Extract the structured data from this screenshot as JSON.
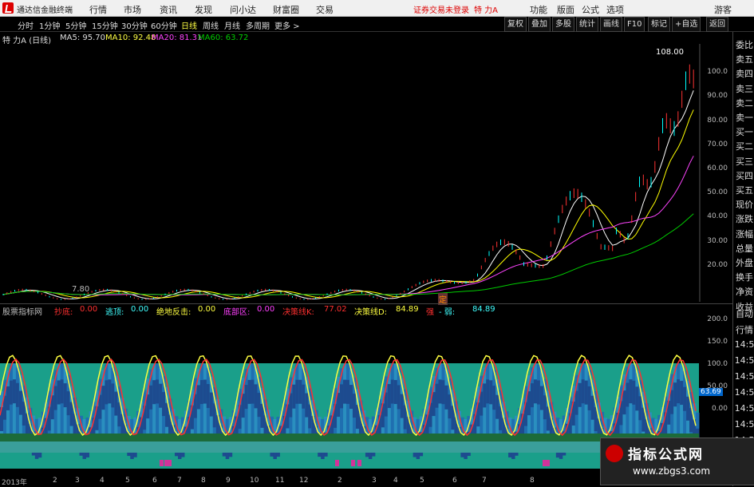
{
  "app": {
    "title": "通达信金融终端"
  },
  "menu": [
    "行情",
    "市场",
    "资讯",
    "发现",
    "问小达",
    "财富圈",
    "交易"
  ],
  "notice": "证券交易未登录",
  "stock_title": "特 力A",
  "right_buttons": [
    "功能",
    "版面",
    "公式",
    "选项",
    "游客"
  ],
  "periods": [
    "分时",
    "1分钟",
    "5分钟",
    "15分钟",
    "30分钟",
    "60分钟",
    "日线",
    "周线",
    "月线",
    "多周期",
    "更多 >"
  ],
  "active_period": "日线",
  "toolbar": [
    "复权",
    "叠加",
    "多股",
    "统计",
    "画线",
    "F10",
    "标记",
    "+自选",
    "返回"
  ],
  "main_chart": {
    "name": "特 力A (日线)",
    "ma5": "MA5: 95.70",
    "ma10": "MA10: 92.48",
    "ma20": "MA20: 81.31",
    "ma60": "MA60: 63.72",
    "price_high": "108.00",
    "price_low": "7.80",
    "marker": "定",
    "y_ticks": [
      "100.0",
      "90.00",
      "80.00",
      "70.00",
      "60.00",
      "50.00",
      "40.00",
      "30.00",
      "20.00"
    ],
    "colors": {
      "ma5": "#ffffff",
      "ma10": "#ffff00",
      "ma20": "#ff44ff",
      "ma60": "#00cc00",
      "up": "#ff3333",
      "down": "#00ffff"
    }
  },
  "indicator": {
    "name": "股票指标网",
    "fields": [
      {
        "label": "抄底:",
        "value": "0.00",
        "color": "#ff3030"
      },
      {
        "label": "逃顶:",
        "value": "0.00",
        "color": "#40ffff"
      },
      {
        "label": "绝地反击:",
        "value": "0.00",
        "color": "#ffff40"
      },
      {
        "label": "底部区:",
        "value": "0.00",
        "color": "#ff40ff"
      },
      {
        "label": "决策线K:",
        "value": "77.02",
        "color": "#ff3030"
      },
      {
        "label": "决策线D:",
        "value": "84.89",
        "color": "#ffff40"
      },
      {
        "label": "强",
        "value": "",
        "color": "#ff3030"
      },
      {
        "label": "- 弱:",
        "value": "84.89",
        "color": "#40ffff"
      }
    ],
    "y_ticks": [
      "200.0",
      "150.0",
      "100.0",
      "50.00",
      "0.00"
    ],
    "value_box": "63.69"
  },
  "right_panel": [
    "委比",
    "卖五",
    "卖四",
    "卖三",
    "卖二",
    "卖一",
    "买一",
    "买二",
    "买三",
    "买四",
    "买五",
    "现价",
    "涨跌",
    "涨幅",
    "总量",
    "外盘",
    "换手",
    "净资",
    "收益",
    "自动",
    "行情",
    "14:5",
    "14:5",
    "14:5",
    "14:5",
    "14:5",
    "14:5",
    "14:5"
  ],
  "x_axis": [
    "2013年",
    "2",
    "3",
    "4",
    "5",
    "6",
    "7",
    "8",
    "9",
    "10",
    "11",
    "12",
    "2",
    "3",
    "4",
    "5",
    "6",
    "7",
    "8"
  ],
  "watermark": {
    "line1": "指标公式网",
    "line2": "www.zbgs3.com"
  }
}
